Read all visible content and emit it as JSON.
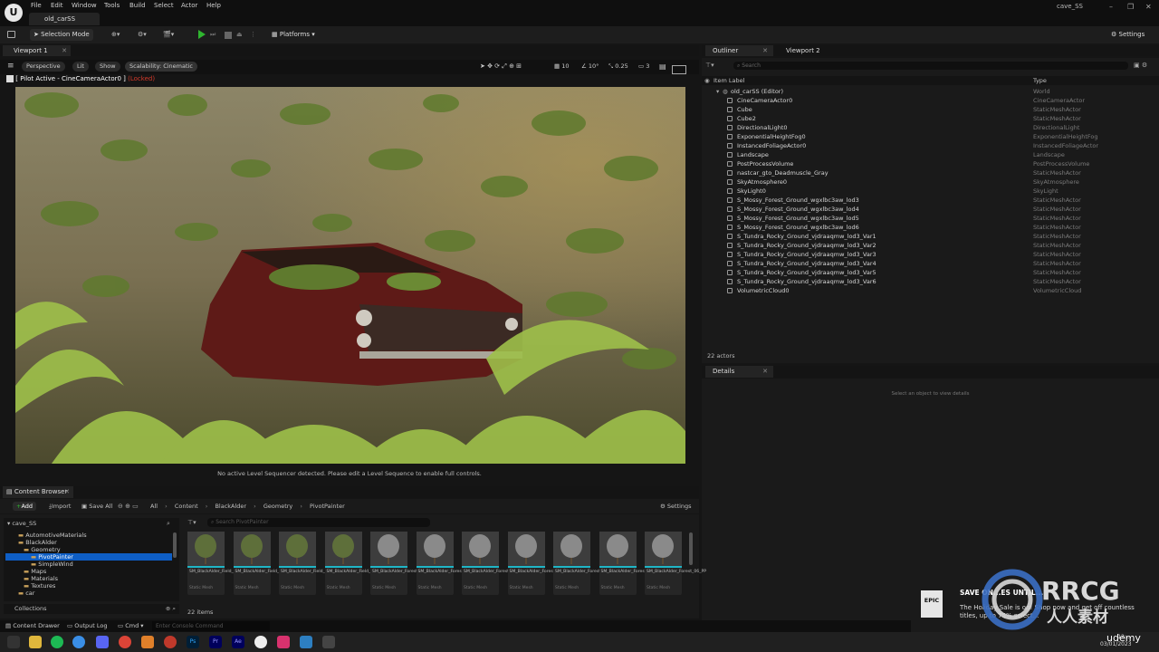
{
  "window": {
    "menu": [
      "File",
      "Edit",
      "Window",
      "Tools",
      "Build",
      "Select",
      "Actor",
      "Help"
    ],
    "level_tab": "old_carSS",
    "project_name": "cave_SS"
  },
  "toolbar": {
    "selection_mode": "Selection Mode",
    "platforms": "Platforms",
    "settings": "Settings"
  },
  "viewport": {
    "tab": "Viewport 1",
    "perspective": "Perspective",
    "lit": "Lit",
    "show": "Show",
    "scalability": "Scalability: Cinematic",
    "grid": "10",
    "rotation": "10°",
    "scale": "0.25",
    "camera_speed": "3",
    "pilot_label": "[ Pilot Active - CineCameraActor0 ]",
    "locked": "(Locked)",
    "status": "No active Level Sequencer detected. Please edit a Level Sequence to enable full controls."
  },
  "outliner": {
    "tab": "Outliner",
    "tab2": "Viewport 2",
    "search_placeholder": "Search",
    "col_label": "Item Label",
    "col_type": "Type",
    "root": {
      "name": "old_carSS (Editor)",
      "type": "World"
    },
    "rows": [
      {
        "name": "CineCameraActor0",
        "type": "CineCameraActor"
      },
      {
        "name": "Cube",
        "type": "StaticMeshActor"
      },
      {
        "name": "Cube2",
        "type": "StaticMeshActor"
      },
      {
        "name": "DirectionalLight0",
        "type": "DirectionalLight"
      },
      {
        "name": "ExponentialHeightFog0",
        "type": "ExponentialHeightFog"
      },
      {
        "name": "InstancedFoliageActor0",
        "type": "InstancedFoliageActor"
      },
      {
        "name": "Landscape",
        "type": "Landscape"
      },
      {
        "name": "PostProcessVolume",
        "type": "PostProcessVolume"
      },
      {
        "name": "nastcar_gto_Deadmuscle_Gray",
        "type": "StaticMeshActor"
      },
      {
        "name": "SkyAtmosphere0",
        "type": "SkyAtmosphere"
      },
      {
        "name": "SkyLight0",
        "type": "SkyLight"
      },
      {
        "name": "S_Mossy_Forest_Ground_wgxlbc3aw_lod3",
        "type": "StaticMeshActor"
      },
      {
        "name": "S_Mossy_Forest_Ground_wgxlbc3aw_lod4",
        "type": "StaticMeshActor"
      },
      {
        "name": "S_Mossy_Forest_Ground_wgxlbc3aw_lod5",
        "type": "StaticMeshActor"
      },
      {
        "name": "S_Mossy_Forest_Ground_wgxlbc3aw_lod6",
        "type": "StaticMeshActor"
      },
      {
        "name": "S_Tundra_Rocky_Ground_vjdraaqmw_lod3_Var1",
        "type": "StaticMeshActor"
      },
      {
        "name": "S_Tundra_Rocky_Ground_vjdraaqmw_lod3_Var2",
        "type": "StaticMeshActor"
      },
      {
        "name": "S_Tundra_Rocky_Ground_vjdraaqmw_lod3_Var3",
        "type": "StaticMeshActor"
      },
      {
        "name": "S_Tundra_Rocky_Ground_vjdraaqmw_lod3_Var4",
        "type": "StaticMeshActor"
      },
      {
        "name": "S_Tundra_Rocky_Ground_vjdraaqmw_lod3_Var5",
        "type": "StaticMeshActor"
      },
      {
        "name": "S_Tundra_Rocky_Ground_vjdraaqmw_lod3_Var6",
        "type": "StaticMeshActor"
      },
      {
        "name": "VolumetricCloud0",
        "type": "VolumetricCloud"
      }
    ],
    "actor_count": "22 actors"
  },
  "details": {
    "tab": "Details",
    "hint": "Select an object to view details"
  },
  "content_browser": {
    "tab": "Content Browser",
    "add": "Add",
    "import": "Import",
    "save_all": "Save All",
    "breadcrumb": [
      "All",
      "Content",
      "BlackAlder",
      "Geometry",
      "PivotPainter"
    ],
    "settings": "Settings",
    "root": "cave_SS",
    "search_placeholder": "Search PivotPainter",
    "tree": [
      "AutomotiveMaterials",
      "BlackAlder",
      "Geometry",
      "PivotPainter",
      "SimpleWind",
      "Maps",
      "Materials",
      "Textures",
      "car"
    ],
    "assets": [
      {
        "label": "SM_BlackAlder_Field_01_PP",
        "sub": "Static Mesh"
      },
      {
        "label": "SM_BlackAlder_Field_02_PP",
        "sub": "Static Mesh"
      },
      {
        "label": "SM_BlackAlder_Field_03_PP",
        "sub": "Static Mesh"
      },
      {
        "label": "SM_BlackAlder_Field_04_PP",
        "sub": "Static Mesh"
      },
      {
        "label": "SM_BlackAlder_Forest_01_PP",
        "sub": "Static Mesh"
      },
      {
        "label": "SM_BlackAlder_Forest_01_PP",
        "sub": "Static Mesh"
      },
      {
        "label": "SM_BlackAlder_Forest_02_PP",
        "sub": "Static Mesh"
      },
      {
        "label": "SM_BlackAlder_Forest_03_PP",
        "sub": "Static Mesh"
      },
      {
        "label": "SM_BlackAlder_Forest_04_PP",
        "sub": "Static Mesh"
      },
      {
        "label": "SM_BlackAlder_Forest_05_PP",
        "sub": "Static Mesh"
      },
      {
        "label": "SM_BlackAlder_Forest_06_PP",
        "sub": "Static Mesh"
      }
    ],
    "items_count": "22 items",
    "collections": "Collections"
  },
  "statusbar": {
    "content_drawer": "Content Drawer",
    "output_log": "Output Log",
    "cmd": "Cmd",
    "cmd_placeholder": "Enter Console Command"
  },
  "notification": {
    "title": "SAVE ON...ES UNTIL...",
    "body": "The Holiday Sale is on! Shop now and get off countless titles, up to 75% select..."
  },
  "watermark": {
    "brand": "RRCG",
    "sub": "人人素材",
    "udemy": "udemy"
  },
  "clock": {
    "time": "12:...",
    "date": "03/01/2023"
  },
  "colors": {
    "accent": "#0e5ec5",
    "locked": "#d23a2a",
    "play": "#2fb52f"
  }
}
